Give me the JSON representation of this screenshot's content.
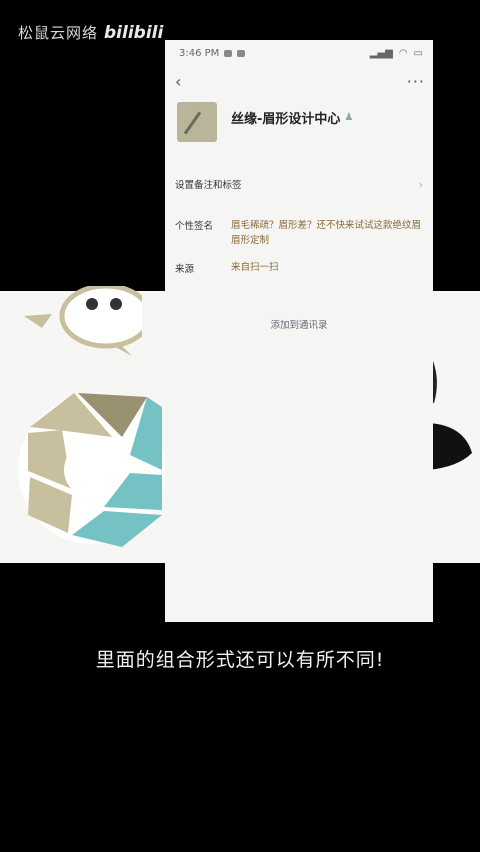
{
  "watermark": {
    "channel": "松鼠云网络",
    "site": "bilibili"
  },
  "status": {
    "time": "3:46 PM"
  },
  "contact": {
    "name": "丝缘-眉形设计中心",
    "remark_label": "设置备注和标签",
    "signature_label": "个性签名",
    "signature": "眉毛稀疏？眉形差？还不快来试试这款绝纹眉 眉形定制",
    "source_label": "来源",
    "source": "来自扫一扫",
    "add_button": "添加到通讯录"
  },
  "subtitle": "里面的组合形式还可以有所不同!",
  "colors": {
    "aperture_beige": "#c8bf9f",
    "aperture_teal": "#74c2c3",
    "accent_text": "#8a6a3a"
  }
}
